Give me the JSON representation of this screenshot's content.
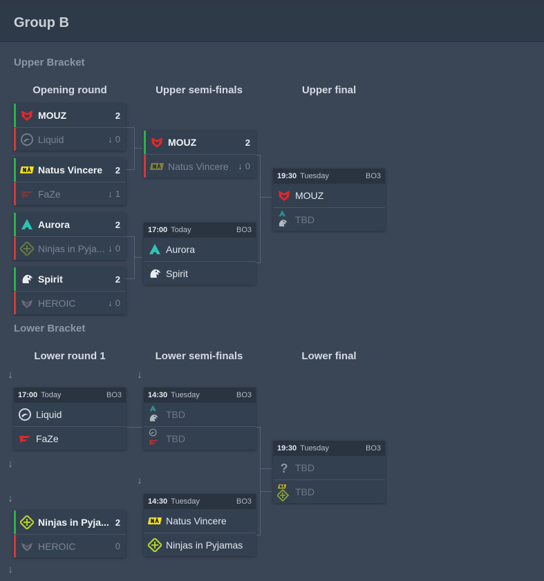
{
  "group_title": "Group B",
  "upper": {
    "title": "Upper Bracket",
    "rounds": [
      "Opening round",
      "Upper semi-finals",
      "Upper final"
    ],
    "r1": [
      {
        "team1": "MOUZ",
        "score1": "2",
        "team2": "Liquid",
        "score2": "0"
      },
      {
        "team1": "Natus Vincere",
        "score1": "2",
        "team2": "FaZe",
        "score2": "1"
      },
      {
        "team1": "Aurora",
        "score1": "2",
        "team2": "Ninjas in Pyja...",
        "score2": "0"
      },
      {
        "team1": "Spirit",
        "score1": "2",
        "team2": "HEROIC",
        "score2": "0"
      }
    ],
    "semi1": {
      "team1": "MOUZ",
      "score1": "2",
      "team2": "Natus Vincere",
      "score2": "0"
    },
    "semi2": {
      "time": "17:00",
      "day": "Today",
      "format": "BO3",
      "team1": "Aurora",
      "team2": "Spirit"
    },
    "final": {
      "time": "19:30",
      "day": "Tuesday",
      "format": "BO3",
      "team1": "MOUZ",
      "team2": "TBD"
    }
  },
  "lower": {
    "title": "Lower Bracket",
    "rounds": [
      "Lower round 1",
      "Lower semi-finals",
      "Lower final"
    ],
    "r1a": {
      "time": "17:00",
      "day": "Today",
      "format": "BO3",
      "team1": "Liquid",
      "team2": "FaZe"
    },
    "r1b": {
      "team1": "Ninjas in Pyja...",
      "score1": "2",
      "team2": "HEROIC",
      "score2": "0"
    },
    "semi1": {
      "time": "14:30",
      "day": "Tuesday",
      "format": "BO3",
      "team1": "TBD",
      "team2": "TBD"
    },
    "semi2": {
      "time": "14:30",
      "day": "Tuesday",
      "format": "BO3",
      "team1": "Natus Vincere",
      "team2": "Ninjas in Pyjamas"
    },
    "final": {
      "time": "19:30",
      "day": "Tuesday",
      "format": "BO3",
      "team1": "TBD",
      "team2": "TBD"
    }
  },
  "drop_arrow": "↓",
  "colors": {
    "win": "#2bb24a",
    "lose": "#d23a3a",
    "mouz": "#e3262a",
    "navi": "#f5e21b",
    "aurora": "#2ec3b5",
    "nip": "#b4d22b",
    "faze": "#d82a2a"
  },
  "icons": {
    "mouz": "mouz-logo-icon",
    "liquid": "liquid-logo-icon",
    "navi": "navi-logo-icon",
    "faze": "faze-logo-icon",
    "aurora": "aurora-logo-icon",
    "nip": "nip-logo-icon",
    "spirit": "spirit-logo-icon",
    "heroic": "heroic-logo-icon",
    "unknown": "question-mark-icon"
  }
}
